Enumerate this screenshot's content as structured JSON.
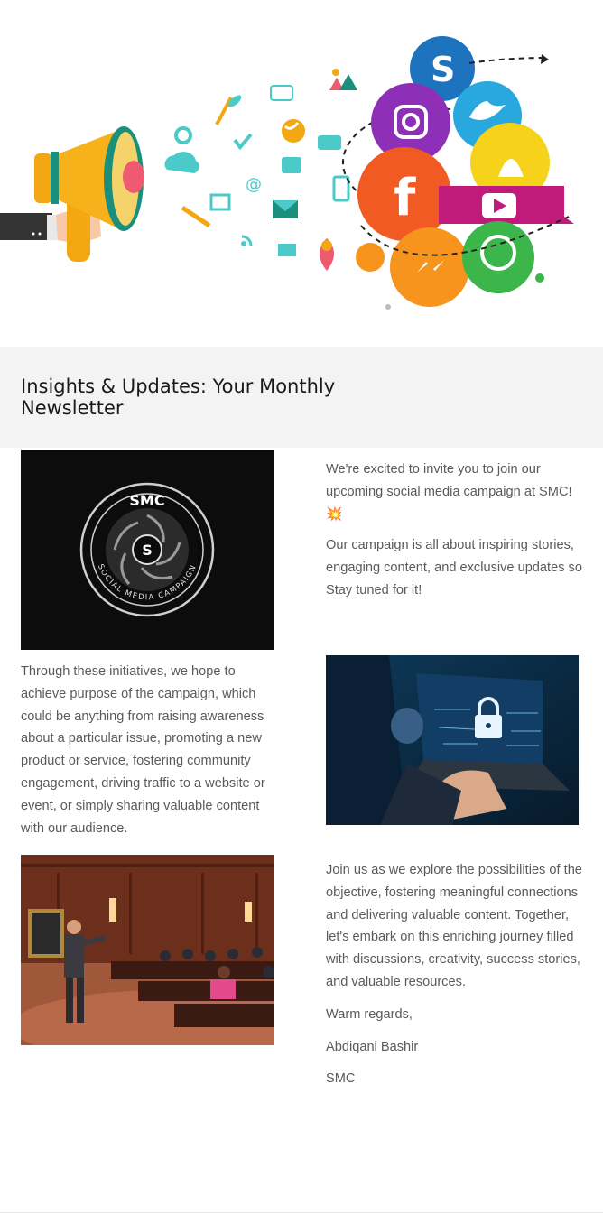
{
  "newsletter": {
    "title": "Insights & Updates: Your Monthly Newsletter"
  },
  "hero": {
    "icon": "social-media-megaphone-illustration"
  },
  "smc_logo": {
    "top_text": "SMC",
    "center_letter": "S",
    "ring_text": "SOCIAL MEDIA CAMPAIGN"
  },
  "section1": {
    "p1": "We're excited to invite you to join our upcoming social media campaign at SMC!",
    "emoji": "💥",
    "p2": "Our campaign is all about  inspiring stories, engaging content, and exclusive updates  so Stay tuned for it!"
  },
  "section2": {
    "p1": "Through these initiatives, we hope to achieve purpose of the campaign, which could be anything from raising awareness about a particular issue, promoting a new product or service, fostering community engagement, driving traffic to a website or event, or simply sharing valuable content with our audience."
  },
  "section3": {
    "p1": "Join us as we explore the possibilities of the  objective, fostering meaningful connections and delivering valuable content. Together, let's embark on this enriching journey filled with discussions, creativity, success stories, and valuable resources.",
    "closing": "Warm regards,",
    "name": "Abdiqani Bashir",
    "org": "SMC"
  },
  "colors": {
    "title_band_bg": "#f3f3f3",
    "body_text": "#5a5a5a"
  }
}
